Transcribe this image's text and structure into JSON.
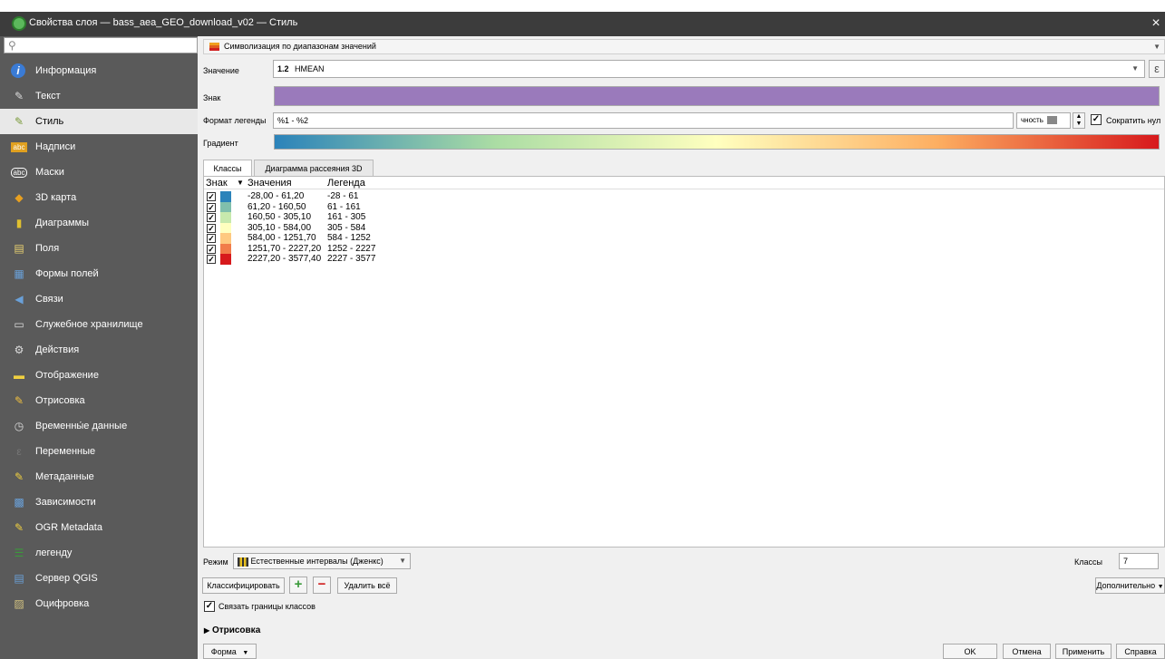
{
  "window": {
    "title": "Свойства слоя — bass_aea_GEO_download_v02 — Стиль",
    "close": "×"
  },
  "sidebar": {
    "search_icon": "⚲",
    "items": [
      {
        "label": "Информация",
        "icon": "info-icon"
      },
      {
        "label": "Текст",
        "icon": "source-icon"
      },
      {
        "label": "Стиль",
        "icon": "symbology-icon"
      },
      {
        "label": "Надписи",
        "icon": "labels-icon"
      },
      {
        "label": "Маски",
        "icon": "masks-icon"
      },
      {
        "label": "3D карта",
        "icon": "3d-icon"
      },
      {
        "label": "Диаграммы",
        "icon": "diagram-icon"
      },
      {
        "label": "Поля",
        "icon": "fields-icon"
      },
      {
        "label": "Формы полей",
        "icon": "form-icon"
      },
      {
        "label": "Связи",
        "icon": "joins-icon"
      },
      {
        "label": "Служебное хранилище",
        "icon": "storage-icon"
      },
      {
        "label": "Действия",
        "icon": "actions-icon"
      },
      {
        "label": "Отображение",
        "icon": "display-icon"
      },
      {
        "label": "Отрисовка",
        "icon": "rendering-icon"
      },
      {
        "label": "Временны́е данные",
        "icon": "temporal-icon"
      },
      {
        "label": "Переменные",
        "icon": "variables-icon"
      },
      {
        "label": "Метаданные",
        "icon": "metadata-icon"
      },
      {
        "label": "Зависимости",
        "icon": "dependencies-icon"
      },
      {
        "label": "OGR Metadata",
        "icon": "ogr-metadata-icon"
      },
      {
        "label": "легенду",
        "icon": "legend-icon"
      },
      {
        "label": "Сервер QGIS",
        "icon": "server-icon"
      },
      {
        "label": "Оцифровка",
        "icon": "digitizing-icon"
      }
    ]
  },
  "renderer": {
    "label": "Символизация по диапазонам значений"
  },
  "value": {
    "label": "Значение",
    "field_prefix": "1.2",
    "field_name": "HMEAN",
    "expr_icon": "ε"
  },
  "symbol": {
    "label": "Знак",
    "color": "#9a7abb"
  },
  "legend_format": {
    "label": "Формат легенды",
    "value": "%1 - %2",
    "precision_label": "чность",
    "trim_label": "Сократить нул",
    "trim_checked": "✓"
  },
  "ramp": {
    "label": "Градиент",
    "colors": [
      "#2b83ba",
      "#abdda4",
      "#ffffbf",
      "#fdae61",
      "#d7191c"
    ]
  },
  "tabs": [
    "Классы",
    "Диаграмма рассеяния 3D"
  ],
  "table": {
    "headers": {
      "symbol": "Знак",
      "values": "Значения",
      "legend": "Легенда",
      "sort_arrow": "▼"
    },
    "rows": [
      {
        "checked": "✓",
        "color": "#2b83ba",
        "values": "-28,00 - 61,20",
        "legend": "-28 - 61"
      },
      {
        "checked": "✓",
        "color": "#80bfac",
        "values": "61,20 - 160,50",
        "legend": "61 - 161"
      },
      {
        "checked": "✓",
        "color": "#c7e9ad",
        "values": "160,50 - 305,10",
        "legend": "161 - 305"
      },
      {
        "checked": "✓",
        "color": "#ffffbf",
        "values": "305,10 - 584,00",
        "legend": "305 - 584"
      },
      {
        "checked": "✓",
        "color": "#fec980",
        "values": "584,00 - 1251,70",
        "legend": "584 - 1252"
      },
      {
        "checked": "✓",
        "color": "#f17c4a",
        "values": "1251,70 - 2227,20",
        "legend": "1252 - 2227"
      },
      {
        "checked": "✓",
        "color": "#d7191c",
        "values": "2227,20 - 3577,40",
        "legend": "2227 - 3577"
      }
    ]
  },
  "mode": {
    "label": "Режим",
    "value": "Естественные интервалы (Дженкс)"
  },
  "classes_count": {
    "label": "Классы",
    "value": "7"
  },
  "buttons": {
    "classify": "Классифицировать",
    "add": "+",
    "remove": "−",
    "delete_all": "Удалить всё",
    "advanced": "Дополнительно",
    "form": "Форма",
    "ok": "OK",
    "cancel": "Отмена",
    "apply": "Применить",
    "help": "Справка"
  },
  "link_boundaries": {
    "label": "Связать границы классов",
    "checked": "✓"
  },
  "rendering_section": {
    "label": "Отрисовка",
    "arrow": "▶"
  }
}
